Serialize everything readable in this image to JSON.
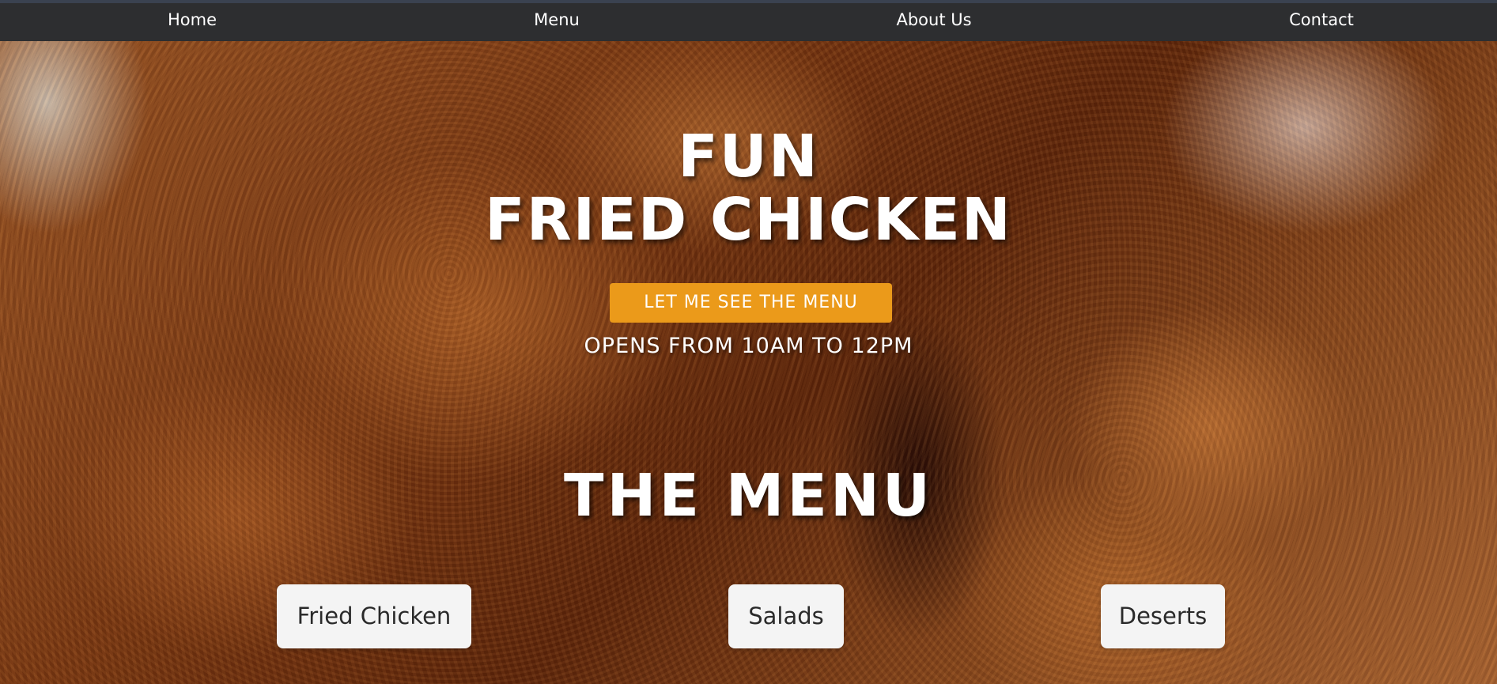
{
  "nav": {
    "items": [
      {
        "label": "Home"
      },
      {
        "label": "Menu"
      },
      {
        "label": "About Us"
      },
      {
        "label": "Contact"
      }
    ]
  },
  "hero": {
    "title_line1": "FUN",
    "title_line2": "FRIED CHICKEN",
    "cta_label": "LET ME SEE THE MENU",
    "hours": "OPENS FROM 10AM TO 12PM",
    "background_image": "fried-chicken-photo"
  },
  "menu": {
    "heading": "THE MENU",
    "categories": [
      {
        "label": "Fried Chicken"
      },
      {
        "label": "Salads"
      },
      {
        "label": "Deserts"
      }
    ]
  },
  "colors": {
    "navbar": "#2d2e30",
    "accent": "#eb9a1a",
    "card": "#f4f4f4",
    "text_light": "#ffffff"
  }
}
